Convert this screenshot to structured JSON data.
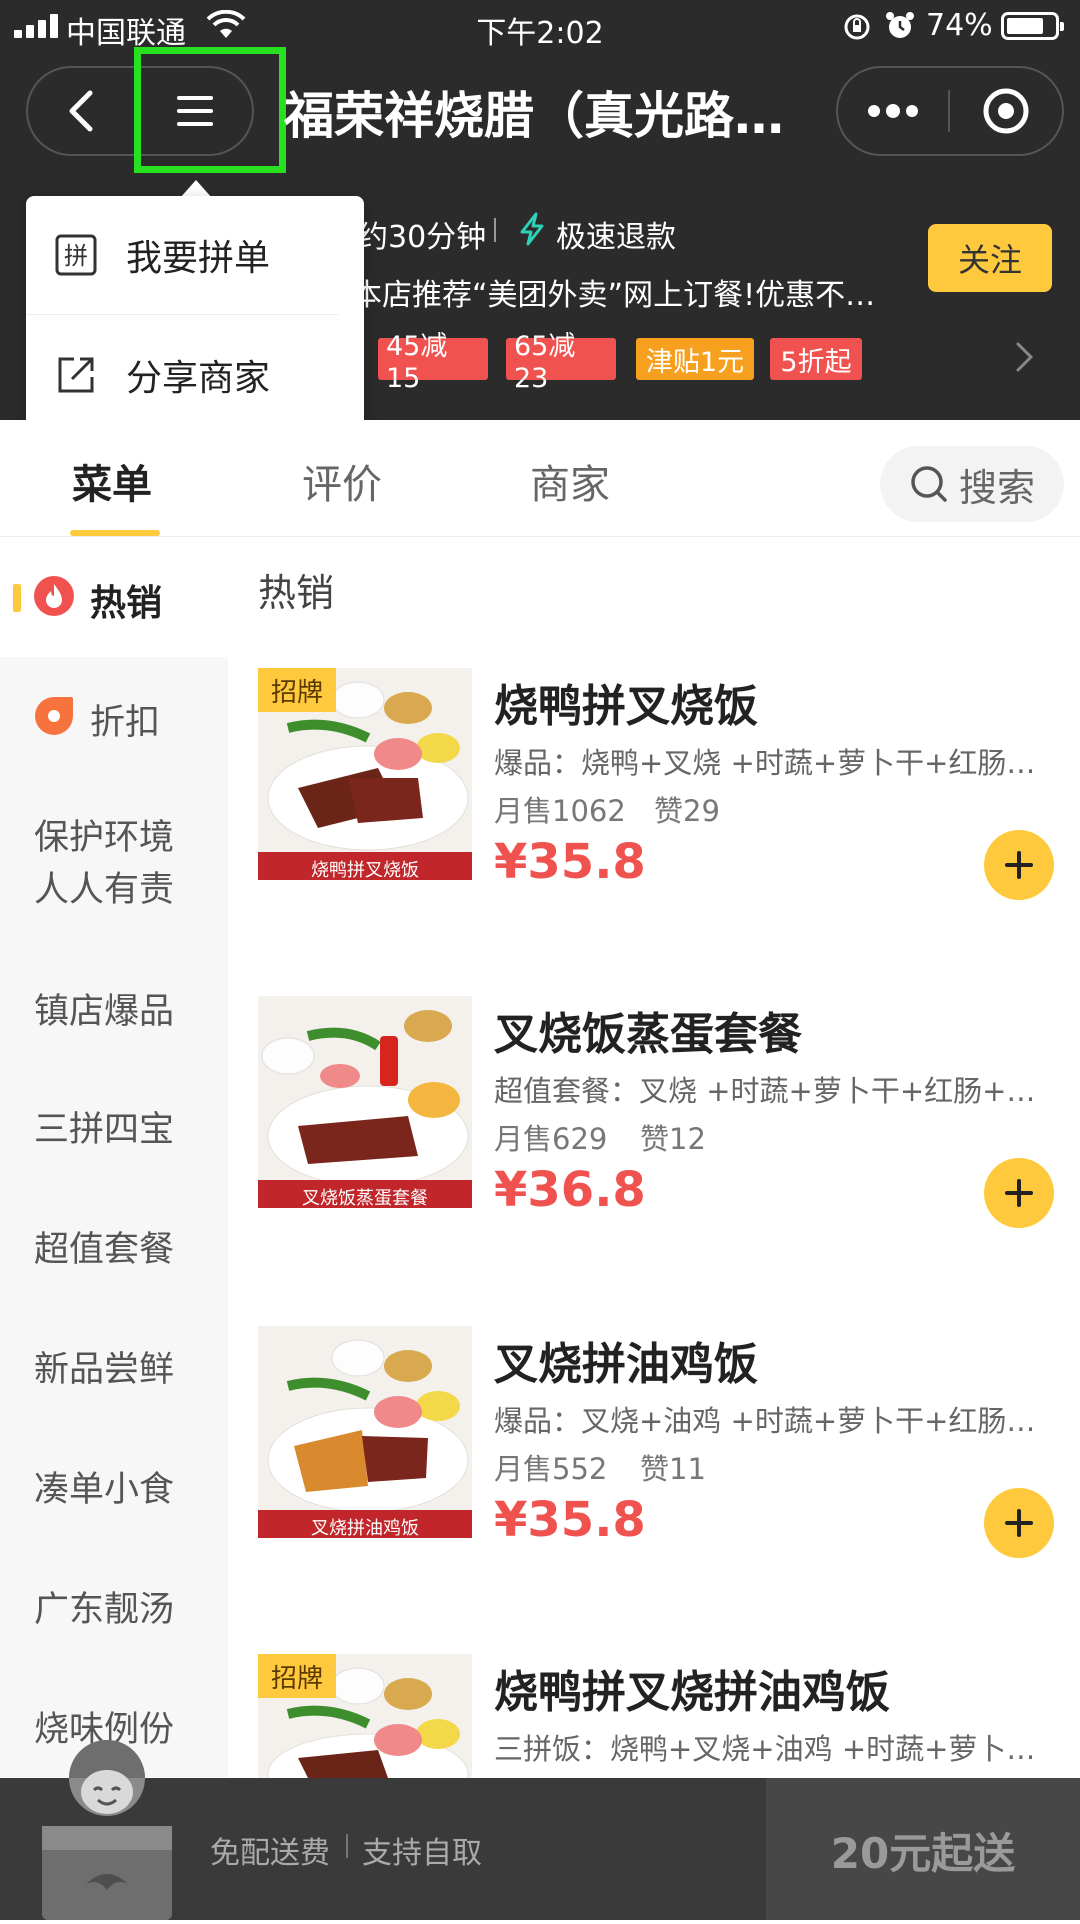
{
  "status_bar": {
    "carrier": "中国联通",
    "time": "下午2:02",
    "battery": "74%"
  },
  "nav": {
    "title": "福荣祥烧腊（真光路…"
  },
  "store": {
    "delivery_time": "约30分钟",
    "refund": "极速退款",
    "notice": "本店推荐“美团外卖”网上订餐!优惠不…",
    "follow_label": "关注",
    "promo_tags": [
      "45减15",
      "65减23",
      "津贴1元",
      "5折起"
    ]
  },
  "dropdown_menu": {
    "items": [
      "我要拼单",
      "分享商家"
    ],
    "join_glyph": "拼"
  },
  "tabs": {
    "menu": "菜单",
    "reviews": "评价",
    "merchant": "商家",
    "search": "搜索"
  },
  "sidebar": {
    "hot": "热销",
    "discount": "折扣",
    "categories": [
      "保护环境人人有责",
      "镇店爆品",
      "三拼四宝",
      "超值套餐",
      "新品尝鲜",
      "凑单小食",
      "广东靓汤",
      "烧味例份"
    ]
  },
  "section_title": "热销",
  "products": [
    {
      "badge": "招牌",
      "name": "烧鸭拼叉烧饭",
      "desc": "爆品：烧鸭+叉烧 +时蔬+萝卜干+红肠…",
      "sales": "月售1062",
      "likes": "赞29",
      "price": "¥35.8",
      "image_caption": "烧鸭拼叉烧饭"
    },
    {
      "badge": "",
      "name": "叉烧饭蒸蛋套餐",
      "desc": "超值套餐：叉烧 +时蔬+萝卜干+红肠+…",
      "sales": "月售629",
      "likes": "赞12",
      "price": "¥36.8",
      "image_caption": "叉烧饭蒸蛋套餐"
    },
    {
      "badge": "",
      "name": "叉烧拼油鸡饭",
      "desc": "爆品：叉烧+油鸡 +时蔬+萝卜干+红肠…",
      "sales": "月售552",
      "likes": "赞11",
      "price": "¥35.8",
      "image_caption": "叉烧拼油鸡饭"
    },
    {
      "badge": "招牌",
      "name": "烧鸭拼叉烧拼油鸡饭",
      "desc": "三拼饭：烧鸭+叉烧+油鸡 +时蔬+萝卜…",
      "sales": "",
      "likes": "",
      "price": "",
      "image_caption": ""
    }
  ],
  "bottom_bar": {
    "free_delivery": "免配送费",
    "pickup": "支持自取",
    "min_order": "20元起送"
  },
  "colors": {
    "header_bg": "#2b2b2b",
    "accent_yellow": "#ffc93d",
    "price_red": "#f0534f",
    "promo_red": "#f0534f",
    "promo_orange": "#f7a020",
    "highlight_green": "#27e020"
  }
}
